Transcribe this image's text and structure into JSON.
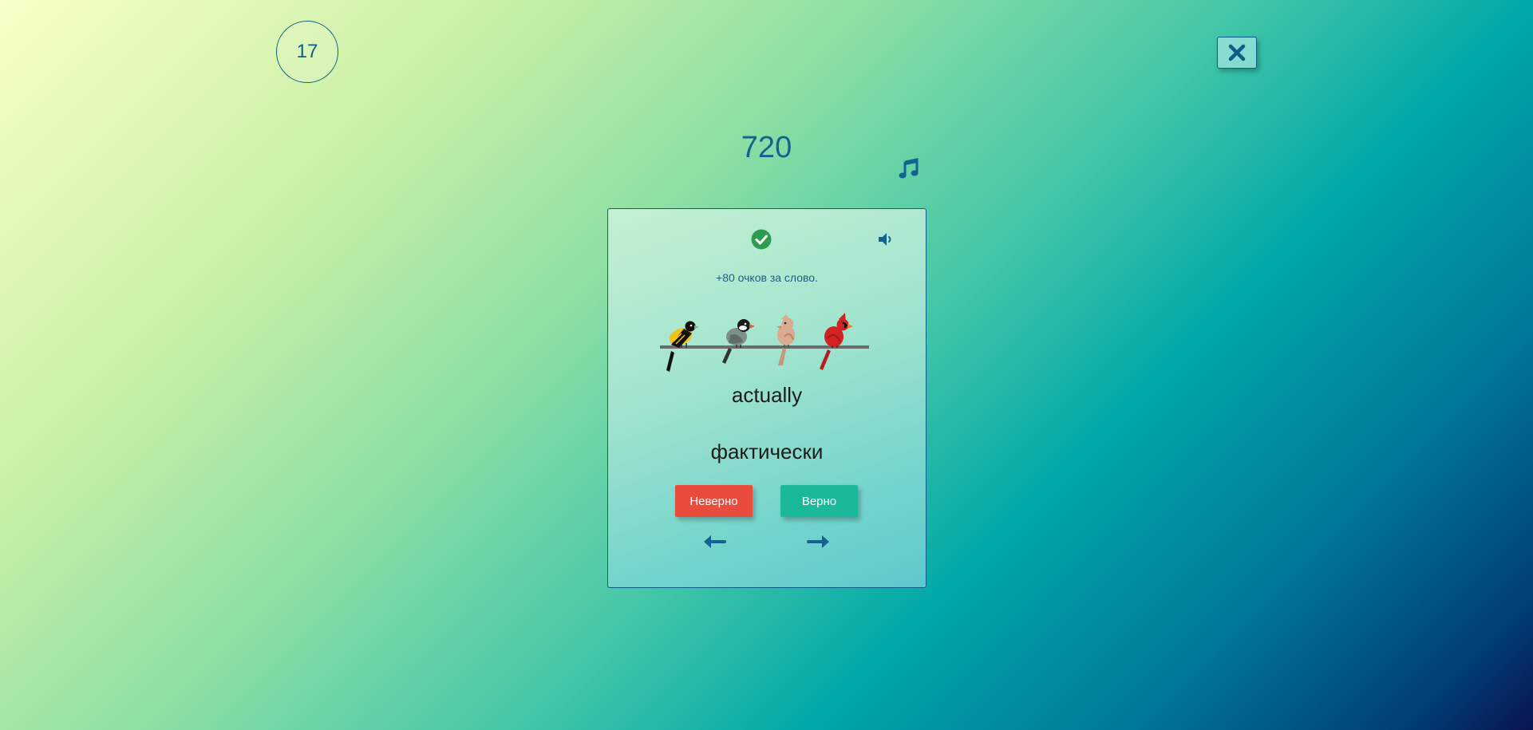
{
  "counter": {
    "value": "17"
  },
  "close": {
    "icon": "close-icon"
  },
  "score": {
    "value": "720"
  },
  "music": {
    "icon": "music-note-icon"
  },
  "card": {
    "status_icon": "check-circle-icon",
    "sound_icon": "speaker-icon",
    "points_text": "+80 очков за слово.",
    "image": "birds-on-wire",
    "word": "actually",
    "translation": "фактически",
    "wrong_label": "Неверно",
    "right_label": "Верно",
    "prev_icon": "arrow-left-icon",
    "next_icon": "arrow-right-icon"
  },
  "colors": {
    "accent": "#0f5e8a",
    "wrong": "#e84c3d",
    "right": "#1ab99a",
    "check": "#2e9c4f"
  }
}
